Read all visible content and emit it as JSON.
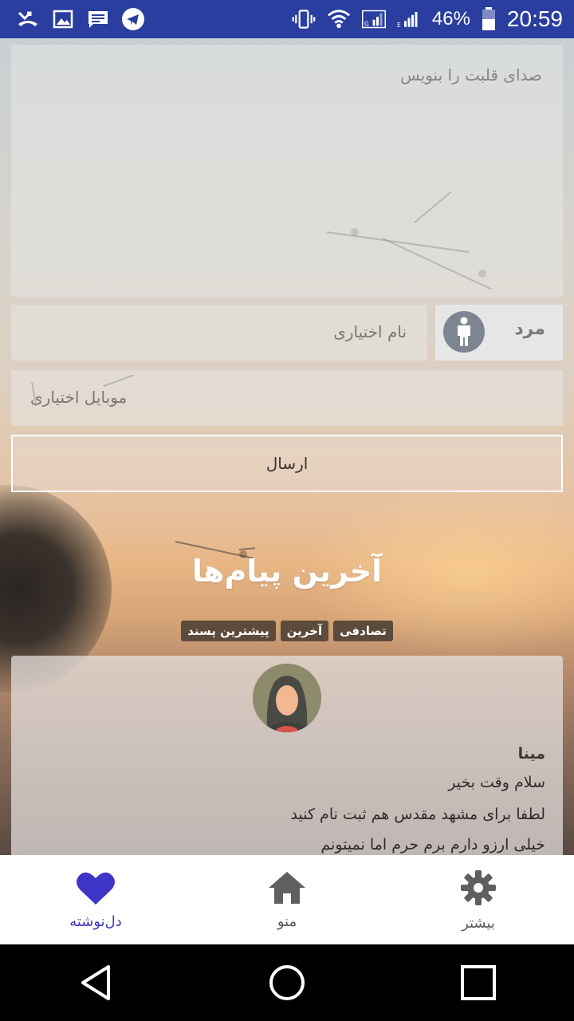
{
  "status_bar": {
    "battery_percent": "46%",
    "time": "20:59",
    "left_icons": [
      "missed-call-icon",
      "gallery-icon",
      "message-icon",
      "telegram-icon"
    ],
    "right_icons": [
      "vibrate-icon",
      "wifi-icon",
      "signal-icon",
      "signal-icon",
      "battery-icon"
    ],
    "color": "#2a3ea0"
  },
  "form": {
    "message_placeholder": "صدای قلبت را بنویس",
    "name_placeholder": "نام اختیاری",
    "gender_label": "مرد",
    "mobile_placeholder": "موبایل اختیاری",
    "send_label": "ارسال"
  },
  "latest": {
    "title": "آخرین پیام‌ها",
    "filters": [
      "تصادفی",
      "آخرین",
      "پیشترین پسند"
    ]
  },
  "message_card": {
    "author": "مینا",
    "lines": [
      "سلام وقت بخیر",
      "لطفا برای مشهد مقدس هم ثبت نام کنید",
      "خیلی ارزو دارم برم حرم اما نمیتونم"
    ]
  },
  "bottom_nav": {
    "items": [
      {
        "label": "دل‌نوشته",
        "icon": "heart-icon",
        "active": true
      },
      {
        "label": "منو",
        "icon": "home-icon",
        "active": false
      },
      {
        "label": "بیشتر",
        "icon": "gear-icon",
        "active": false
      }
    ],
    "active_color": "#3e35c6"
  }
}
